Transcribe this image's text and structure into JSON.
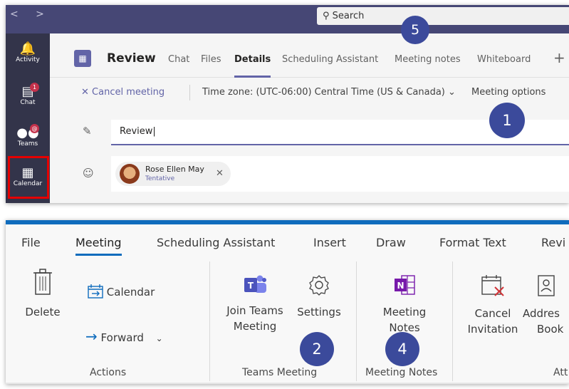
{
  "teams": {
    "nav_arrows": "<  >",
    "search_placeholder": "Search",
    "rail": [
      {
        "label": "Activity",
        "icon": "bell-icon"
      },
      {
        "label": "Chat",
        "icon": "chat-icon",
        "badge": "1"
      },
      {
        "label": "Teams",
        "icon": "teams-icon",
        "badge": "@"
      },
      {
        "label": "Calendar",
        "icon": "calendar-icon"
      }
    ],
    "meeting_title": "Review",
    "tabs": [
      "Chat",
      "Files",
      "Details",
      "Scheduling Assistant",
      "Meeting notes",
      "Whiteboard"
    ],
    "active_tab": "Details",
    "add_tab": "+",
    "cancel_meeting": "Cancel meeting",
    "time_zone": "Time zone: (UTC-06:00) Central Time (US & Canada)",
    "meeting_options": "Meeting options",
    "title_value": "Review",
    "attendee": {
      "name": "Rose Ellen May",
      "status": "Tentative"
    },
    "accent": "#6264a7"
  },
  "ribbon": {
    "tabs": [
      "File",
      "Meeting",
      "Scheduling Assistant",
      "Insert",
      "Draw",
      "Format Text",
      "Revi"
    ],
    "active_tab": "Meeting",
    "buttons": {
      "delete": "Delete",
      "calendar": "Calendar",
      "forward": "Forward",
      "join_teams_1": "Join Teams",
      "join_teams_2": "Meeting",
      "settings": "Settings",
      "meeting_notes_1": "Meeting",
      "meeting_notes_2": "Notes",
      "cancel_1": "Cancel",
      "cancel_2": "Invitation",
      "address_1": "Addres",
      "address_2": "Book"
    },
    "groups": {
      "actions": "Actions",
      "teams_meeting": "Teams Meeting",
      "meeting_notes": "Meeting Notes",
      "attendees": "Att"
    },
    "accent": "#0f6cbd"
  },
  "callouts": [
    "1",
    "2",
    "4",
    "5"
  ],
  "callout_color": "#3b4a9b"
}
